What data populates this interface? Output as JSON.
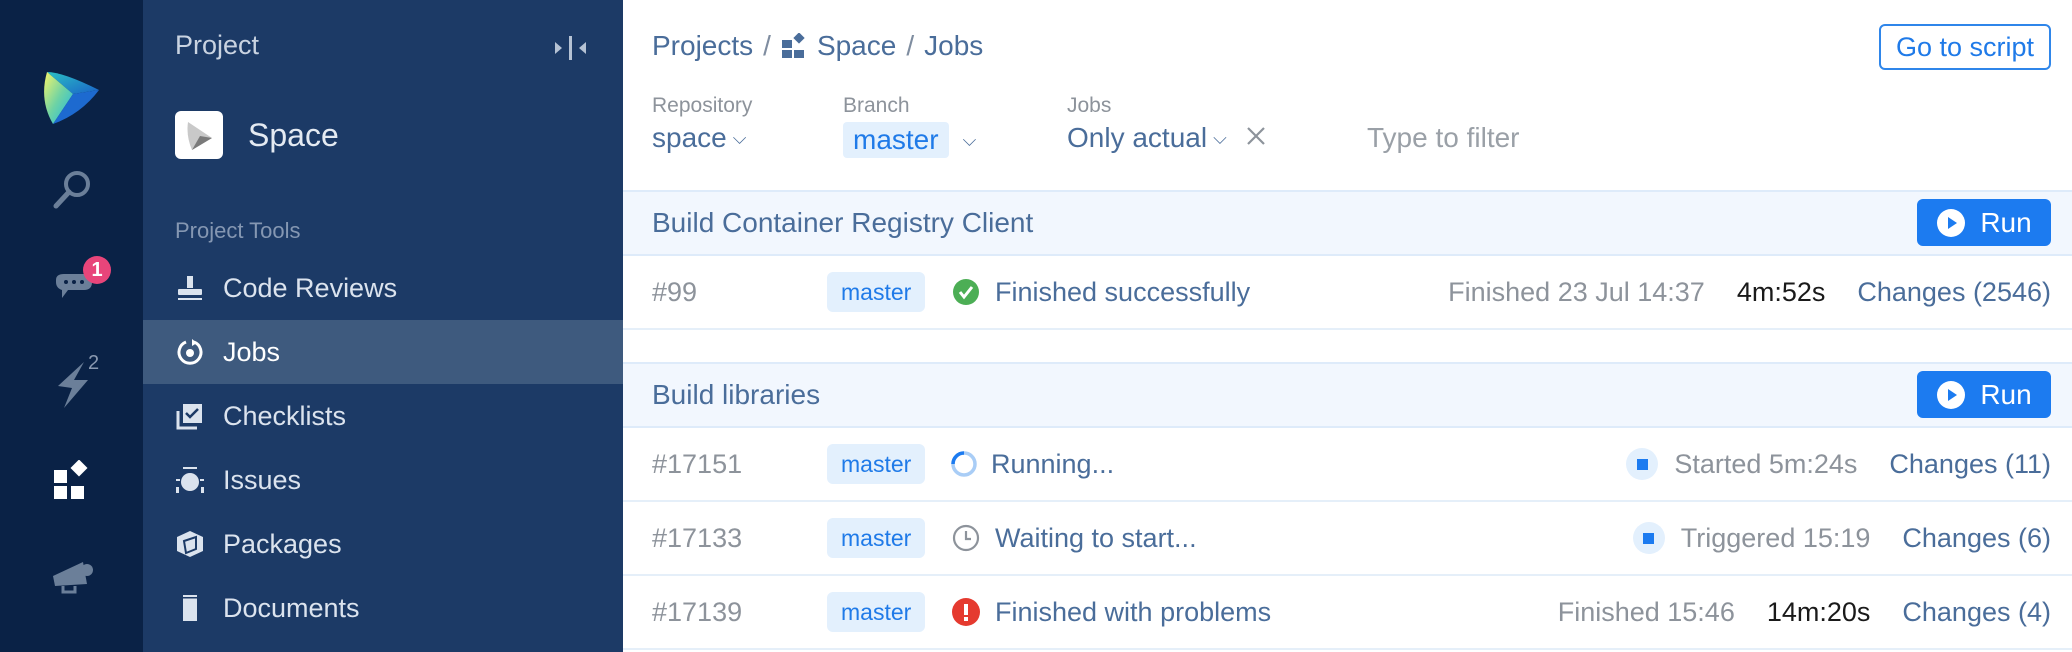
{
  "rail": {
    "items": [
      {
        "icon": "space-logo-icon"
      },
      {
        "icon": "search-icon"
      },
      {
        "icon": "chat-icon",
        "badge": "1"
      },
      {
        "icon": "lightning-icon",
        "count": "2"
      },
      {
        "icon": "projects-icon"
      },
      {
        "icon": "megaphone-icon"
      }
    ]
  },
  "sidebar": {
    "title": "Project",
    "project_name": "Space",
    "section_label": "Project Tools",
    "items": [
      {
        "label": "Code Reviews",
        "icon": "stamp-icon"
      },
      {
        "label": "Jobs",
        "icon": "jobs-icon",
        "active": true
      },
      {
        "label": "Checklists",
        "icon": "checklist-icon"
      },
      {
        "label": "Issues",
        "icon": "bug-icon"
      },
      {
        "label": "Packages",
        "icon": "package-icon"
      },
      {
        "label": "Documents",
        "icon": "document-icon"
      }
    ]
  },
  "header": {
    "breadcrumb": [
      "Projects",
      "Space",
      "Jobs"
    ],
    "separator": "/",
    "go_to_script": "Go to script"
  },
  "filters": {
    "repository": {
      "label": "Repository",
      "value": "space"
    },
    "branch": {
      "label": "Branch",
      "value": "master"
    },
    "jobs": {
      "label": "Jobs",
      "value": "Only actual"
    },
    "search_placeholder": "Type to filter",
    "search_value": ""
  },
  "run_label": "Run",
  "sections": [
    {
      "title": "Build Container Registry Client",
      "rows": [
        {
          "number": "#99",
          "branch": "master",
          "status": "Finished successfully",
          "status_kind": "success",
          "time": "Finished 23 Jul 14:37",
          "duration": "4m:52s",
          "changes": "Changes (2546)"
        }
      ]
    },
    {
      "title": "Build libraries",
      "rows": [
        {
          "number": "#17151",
          "branch": "master",
          "status": "Running...",
          "status_kind": "running",
          "time": "Started 5m:24s",
          "duration": "",
          "changes": "Changes (11)"
        },
        {
          "number": "#17133",
          "branch": "master",
          "status": "Waiting to start...",
          "status_kind": "waiting",
          "time": "Triggered 15:19",
          "duration": "",
          "changes": "Changes (6)"
        },
        {
          "number": "#17139",
          "branch": "master",
          "status": "Finished with problems",
          "status_kind": "failed",
          "time": "Finished 15:46",
          "duration": "14m:20s",
          "changes": "Changes (4)"
        }
      ]
    }
  ],
  "colors": {
    "rail_bg": "#0a2246",
    "sidebar_bg": "#1c3a66",
    "active_item_bg": "#3e5a7e",
    "accent": "#1c7bf0",
    "success": "#4cae55",
    "error": "#e53a2f",
    "badge": "#e8457a"
  }
}
